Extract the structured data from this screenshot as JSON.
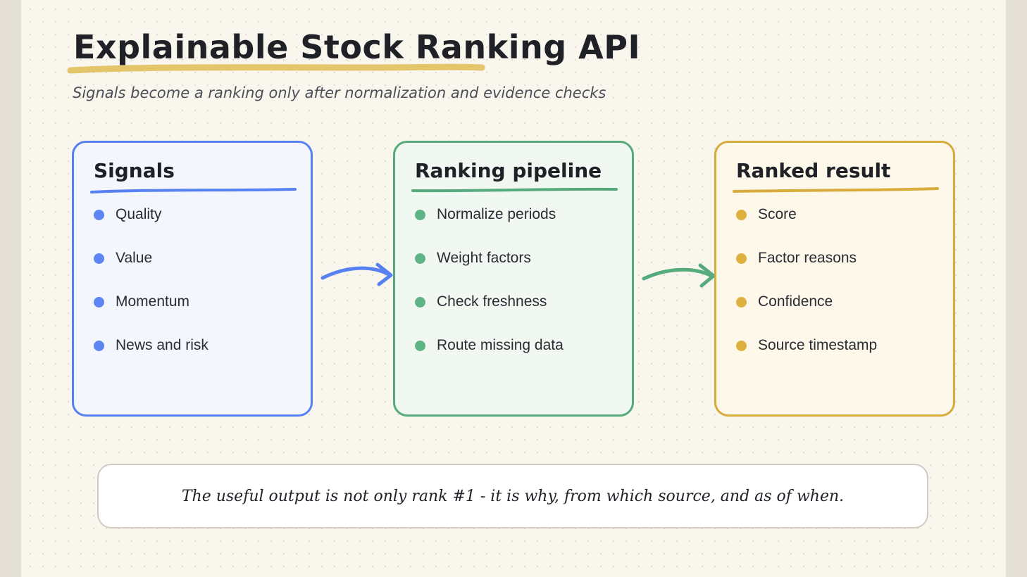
{
  "title": "Explainable Stock Ranking API",
  "subtitle": "Signals become a ranking only after normalization and evidence checks",
  "colors": {
    "signals": "#5781f0",
    "pipeline": "#55ab7b",
    "result": "#d8ac3c",
    "title_underline": "#e4c56a"
  },
  "cards": [
    {
      "title": "Signals",
      "items": [
        "Quality",
        "Value",
        "Momentum",
        "News and risk"
      ]
    },
    {
      "title": "Ranking pipeline",
      "items": [
        "Normalize periods",
        "Weight factors",
        "Check freshness",
        "Route missing data"
      ]
    },
    {
      "title": "Ranked result",
      "items": [
        "Score",
        "Factor reasons",
        "Confidence",
        "Source timestamp"
      ]
    }
  ],
  "callout": "The useful output is not only rank #1 - it is why, from which source, and as of when."
}
